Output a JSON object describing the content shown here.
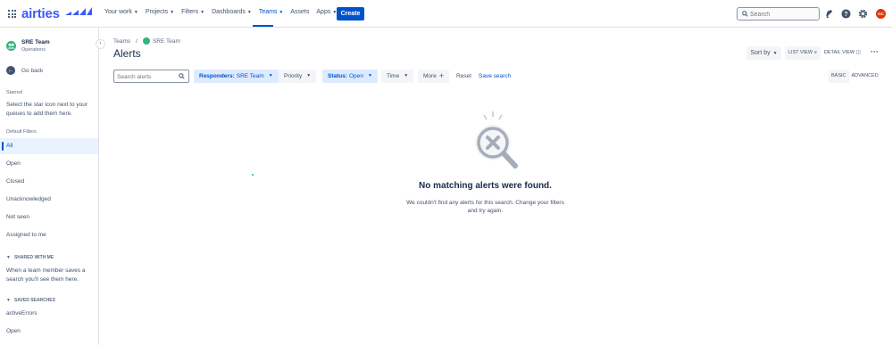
{
  "app": {
    "logo_text": "airties",
    "accent_color": "#0052cc"
  },
  "topnav": {
    "items": [
      {
        "label": "Your work",
        "has_menu": true
      },
      {
        "label": "Projects",
        "has_menu": true
      },
      {
        "label": "Filters",
        "has_menu": true
      },
      {
        "label": "Dashboards",
        "has_menu": true
      },
      {
        "label": "Teams",
        "has_menu": true,
        "active": true
      },
      {
        "label": "Assets",
        "has_menu": false
      },
      {
        "label": "Apps",
        "has_menu": true
      }
    ],
    "create_label": "Create",
    "search_placeholder": "Search",
    "icons": [
      "notifications-icon",
      "help-icon",
      "settings-icon"
    ],
    "avatar_initials": "GC",
    "avatar_color": "#de350b"
  },
  "sidebar": {
    "team_name": "SRE Team",
    "team_sub": "Operations",
    "go_back": "Go back",
    "starred_heading": "Starred",
    "starred_text": "Select the star icon next to your queues to add them here.",
    "default_filters_heading": "Default Filters",
    "filters": [
      "All",
      "Open",
      "Closed",
      "Unacknowledged",
      "Not seen",
      "Assigned to me"
    ],
    "active_filter": "All",
    "shared_heading": "SHARED WITH ME",
    "shared_text": "When a team member saves a search you'll see them here.",
    "saved_heading": "SAVED SEARCHES",
    "saved_searches": [
      "activeErrors",
      "Open"
    ]
  },
  "main": {
    "breadcrumb": [
      "Teams",
      "SRE Team"
    ],
    "title": "Alerts",
    "sort_label": "Sort by",
    "list_view": "LIST VIEW",
    "detail_view": "DETAIL VIEW",
    "filters": {
      "search_placeholder": "Search alerts",
      "responders_key": "Responders:",
      "responders_value": "SRE Team",
      "priority": "Priority",
      "status_key": "Status:",
      "status_value": "Open",
      "time": "Time",
      "more": "More",
      "reset": "Reset",
      "save_search": "Save search",
      "basic": "BASIC",
      "advanced": "ADVANCED"
    },
    "empty": {
      "title": "No matching alerts were found.",
      "description": "We couldn't find any alerts for this search. Change your filters and try again."
    }
  }
}
